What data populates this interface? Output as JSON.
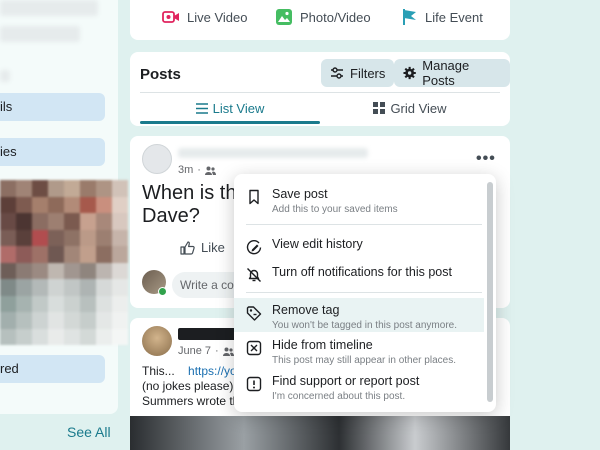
{
  "left": {
    "items": [
      "ils",
      "ies",
      "red"
    ],
    "see_all": "See All"
  },
  "actions": {
    "live_video": "Live Video",
    "photo_video": "Photo/Video",
    "life_event": "Life Event"
  },
  "posts_header": {
    "title": "Posts",
    "filters": "Filters",
    "manage": "Manage Posts",
    "list_view": "List View",
    "grid_view": "Grid View"
  },
  "post1": {
    "time": "3m",
    "question_line1": "When is the",
    "question_line2": "Dave?",
    "like": "Like",
    "comment_placeholder": "Write a cor"
  },
  "post2": {
    "time": "June 7",
    "text_line1": "This...",
    "link": "https://yo",
    "text_line2": "(no jokes please) b",
    "text_line3": "Summers wrote th"
  },
  "menu": {
    "save_title": "Save post",
    "save_sub": "Add this to your saved items",
    "edit_history": "View edit history",
    "notifications_off": "Turn off notifications for this post",
    "remove_tag_title": "Remove tag",
    "remove_tag_sub": "You won't be tagged in this post anymore.",
    "hide_title": "Hide from timeline",
    "hide_sub": "This post may still appear in other places.",
    "report_title": "Find support or report post",
    "report_sub": "I'm concerned about this post."
  },
  "colors": {
    "accent": "#1a7a8c",
    "live_video": "#e0245e",
    "photo": "#45bd62",
    "life_event": "#2a9fb5",
    "background": "#dff1ef"
  }
}
